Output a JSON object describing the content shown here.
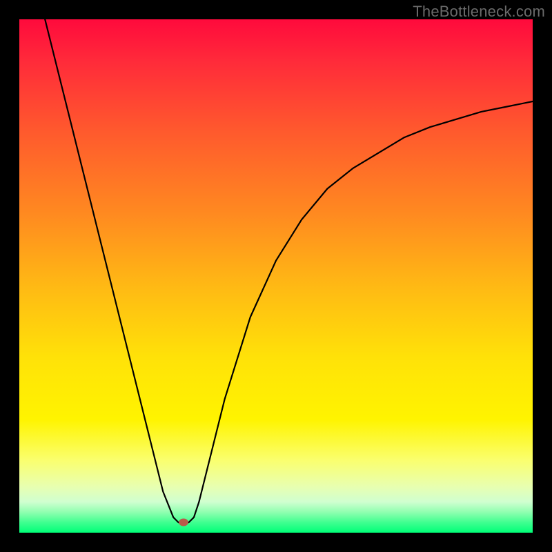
{
  "watermark": "TheBottleneck.com",
  "chart_data": {
    "type": "line",
    "title": "",
    "xlabel": "",
    "ylabel": "",
    "xlim": [
      0,
      100
    ],
    "ylim": [
      0,
      100
    ],
    "background_gradient": {
      "top_color": "#ff0a3c",
      "bottom_color": "#00ff78",
      "meaning": "red (top) = worse, green (bottom) = better"
    },
    "series": [
      {
        "name": "bottleneck-curve",
        "color": "#000000",
        "x": [
          5,
          10,
          15,
          20,
          25,
          28,
          30,
          31,
          32,
          33,
          34,
          35,
          37,
          40,
          45,
          50,
          55,
          60,
          65,
          70,
          75,
          80,
          85,
          90,
          95,
          100
        ],
        "y": [
          100,
          80,
          60,
          40,
          20,
          8,
          3,
          2,
          2,
          2,
          3,
          6,
          14,
          26,
          42,
          53,
          61,
          67,
          71,
          74,
          77,
          79,
          80.5,
          82,
          83,
          84
        ]
      }
    ],
    "marker": {
      "name": "optimal-point",
      "x": 32,
      "y": 2,
      "color": "#b85a4a"
    }
  }
}
